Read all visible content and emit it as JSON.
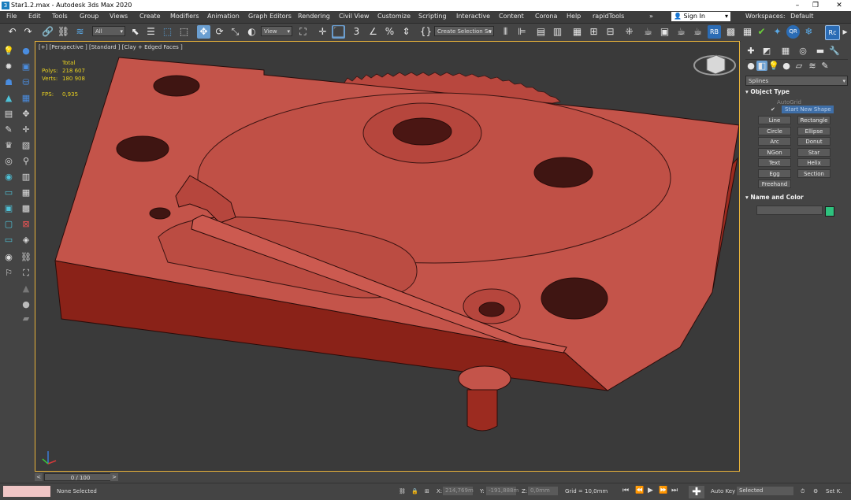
{
  "window": {
    "title": "Star1.2.max - Autodesk 3ds Max 2020",
    "app_icon": "3ds-max-logo-icon"
  },
  "menu": [
    "File",
    "Edit",
    "Tools",
    "Group",
    "Views",
    "Create",
    "Modifiers",
    "Animation",
    "Graph Editors",
    "Rendering",
    "Civil View",
    "Customize",
    "Scripting",
    "Interactive",
    "Content",
    "Corona",
    "Help",
    "rapidTools"
  ],
  "menu_more": "»",
  "signin": {
    "label": "Sign In"
  },
  "workspaces": {
    "label": "Workspaces:",
    "value": "Default"
  },
  "toolbar": {
    "selection_filter": "All",
    "reference_coord": "View",
    "named_selection": "Create Selection Se",
    "rb_label": "RB",
    "qr_label": "QR",
    "rc_label": "Rc"
  },
  "viewport": {
    "label": "[+] [Perspective ] [Standard ] [Clay + Edged Faces ]",
    "stats": {
      "total_label": "Total",
      "polys_label": "Polys:",
      "polys_value": "218 607",
      "verts_label": "Verts:",
      "verts_value": "180 908",
      "fps_label": "FPS:",
      "fps_value": "0,935"
    },
    "model_color": "#c4544a",
    "active_border_color": "#e9b33a"
  },
  "command_panel": {
    "category": "Splines",
    "object_type": {
      "title": "Object Type",
      "autogrid": "AutoGrid",
      "start_new_shape": "Start New Shape",
      "buttons": [
        "Line",
        "Rectangle",
        "Circle",
        "Ellipse",
        "Arc",
        "Donut",
        "NGon",
        "Star",
        "Text",
        "Helix",
        "Egg",
        "Section",
        "Freehand"
      ]
    },
    "name_color": {
      "title": "Name and Color",
      "name_value": "",
      "swatch_color": "#2ec27e"
    }
  },
  "timeline": {
    "frame_display": "0 / 100"
  },
  "status": {
    "selection": "None Selected",
    "x_label": "X:",
    "x_value": "214,769m",
    "y_label": "Y:",
    "y_value": "-191,888m",
    "z_label": "Z:",
    "z_value": "0,0mm",
    "grid": "Grid = 10,0mm",
    "autokey": "Auto Key",
    "key_filter": "Selected",
    "set_key": "Set K."
  }
}
